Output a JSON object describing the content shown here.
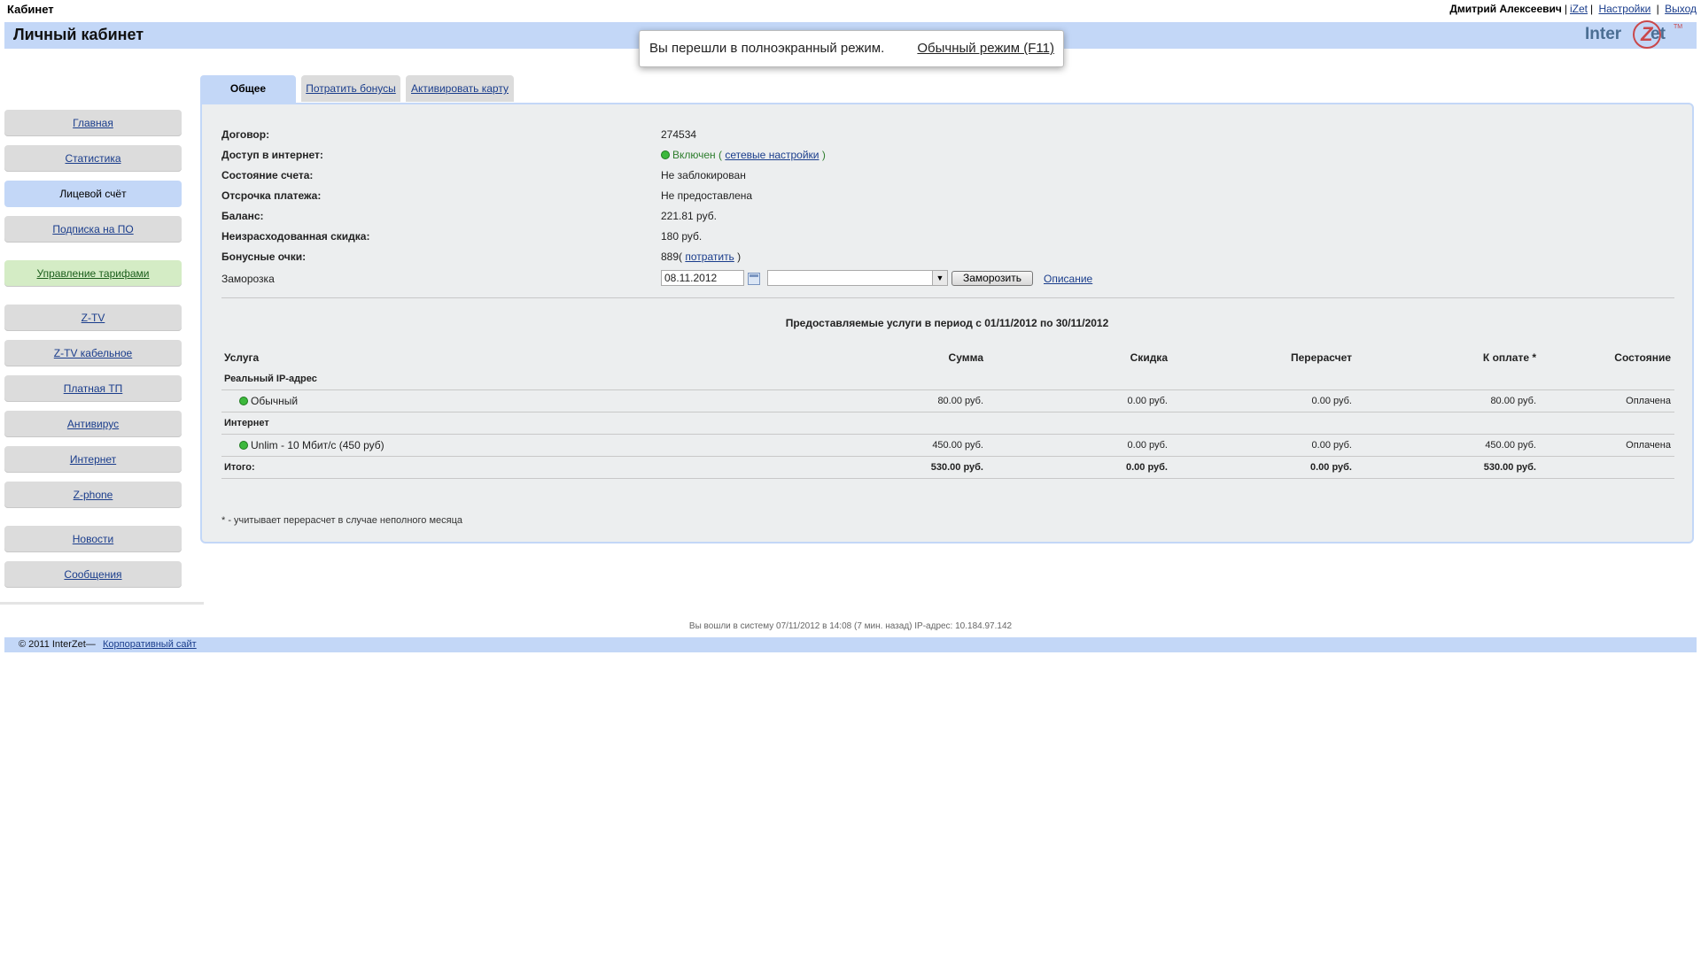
{
  "top": {
    "site_title": "Кабинет",
    "user_name": "Дмитрий Алексеевич",
    "izet": "iZet",
    "settings": "Настройки",
    "logout": "Выход"
  },
  "header": {
    "title": "Личный кабинет",
    "logo_left": "Inter",
    "logo_num": "Z",
    "logo_right": "et",
    "logo_sup": "TM"
  },
  "fullscreen_notice": {
    "message": "Вы перешли в полноэкранный режим.",
    "exit_label": "Обычный режим (F11)"
  },
  "sidebar": {
    "items": [
      {
        "label": "Главная"
      },
      {
        "label": "Статистика"
      },
      {
        "label": "Лицевой счёт"
      },
      {
        "label": "Подписка на ПО"
      },
      {
        "label": "Управление тарифами"
      },
      {
        "label": "Z-TV"
      },
      {
        "label": "Z-TV кабельное"
      },
      {
        "label": "Платная ТП"
      },
      {
        "label": "Антивирус"
      },
      {
        "label": "Интернет"
      },
      {
        "label": "Z-phone"
      },
      {
        "label": "Новости"
      },
      {
        "label": "Сообщения"
      }
    ],
    "active_index": 2
  },
  "tabs": [
    {
      "label": "Общее"
    },
    {
      "label": "Потратить бонусы"
    },
    {
      "label": "Активировать карту"
    }
  ],
  "account": {
    "contract_label": "Договор:",
    "contract_value": "274534",
    "internet_label": "Доступ в интернет:",
    "internet_value": "Включен",
    "internet_open": "(",
    "internet_link": "сетевые настройки",
    "internet_close": ")",
    "state_label": "Состояние счета:",
    "state_value": "Не заблокирован",
    "deferral_label": "Отсрочка платежа:",
    "deferral_value": "Не предоставлена",
    "balance_label": "Баланс:",
    "balance_value": "221.81 руб.",
    "discount_label": "Неизрасходованная скидка:",
    "discount_value": "180 руб.",
    "bonus_label": "Бонусные очки:",
    "bonus_value": "889(",
    "bonus_link": "потратить",
    "bonus_close": ")",
    "freeze_label": "Заморозка",
    "freeze_date": "08.11.2012",
    "freeze_select": "",
    "freeze_button": "Заморозить",
    "freeze_desc": "Описание"
  },
  "services": {
    "title": "Предоставляемые услуги в период с 01/11/2012 по 30/11/2012",
    "headers": {
      "name": "Услуга",
      "sum": "Сумма",
      "discount": "Скидка",
      "recalc": "Перерасчет",
      "to_pay": "К оплате *",
      "state": "Состояние"
    },
    "groups": [
      {
        "name": "Реальный IP-адрес",
        "rows": [
          {
            "name": "Обычный",
            "sum": "80.00 руб.",
            "discount": "0.00 руб.",
            "recalc": "0.00 руб.",
            "to_pay": "80.00 руб.",
            "state": "Оплачена"
          }
        ]
      },
      {
        "name": "Интернет",
        "rows": [
          {
            "name": "Unlim - 10 Мбит/с (450 руб)",
            "sum": "450.00 руб.",
            "discount": "0.00 руб.",
            "recalc": "0.00 руб.",
            "to_pay": "450.00 руб.",
            "state": "Оплачена"
          }
        ]
      }
    ],
    "total": {
      "label": "Итого:",
      "sum": "530.00 руб.",
      "discount": "0.00 руб.",
      "recalc": "0.00 руб.",
      "to_pay": "530.00 руб."
    },
    "footnote": "* - учитывает перерасчет в случае неполного месяца"
  },
  "footer": {
    "login_info": "Вы вошли в систему 07/11/2012 в 14:08 (7 мин. назад) IP-адрес: 10.184.97.142",
    "copyright": "© 2011 InterZet—",
    "corp_link": "Корпоративный сайт"
  },
  "colors": {
    "accent_blue": "#c3d7f7",
    "panel_bg": "#eceeef",
    "link": "#1a3d8c",
    "ok_green": "#2d7d2d",
    "status_dot": "#3cb83c"
  }
}
